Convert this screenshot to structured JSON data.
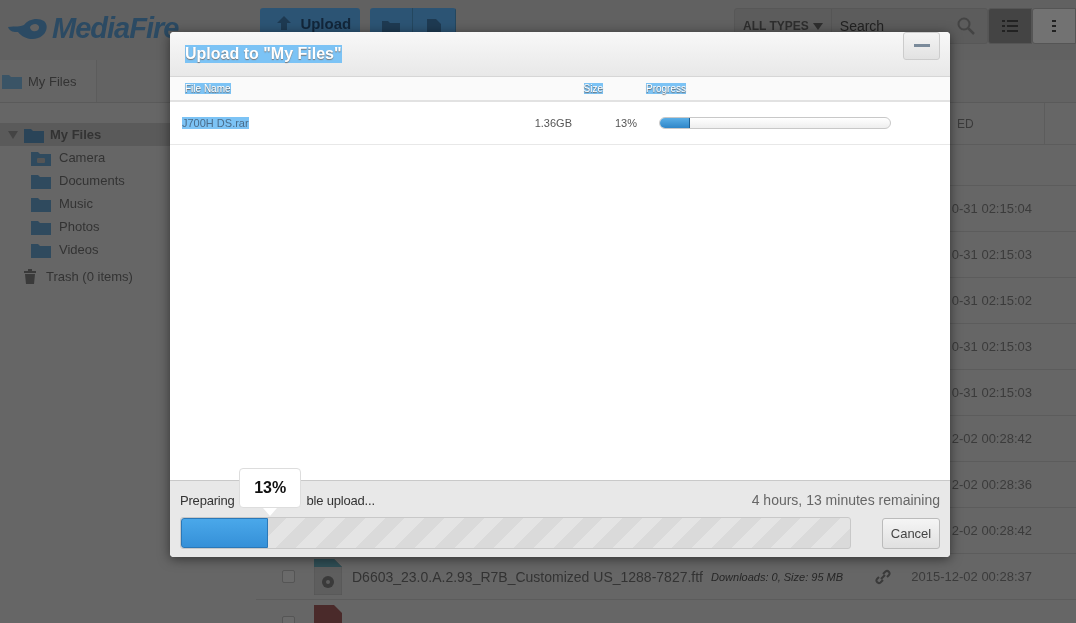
{
  "app": {
    "logo": "MediaFire",
    "upload_button": "Upload",
    "filter": "ALL TYPES",
    "search": {
      "placeholder": "Search"
    },
    "view_buttons": [
      {
        "kind": "list",
        "selected": true
      },
      {
        "kind": "grid",
        "selected": false
      }
    ],
    "breadcrumb": "My Files",
    "sidebar": {
      "tree": [
        {
          "label": "My Files",
          "selected": true,
          "expanded": true,
          "children": [
            {
              "label": "Camera",
              "kind": "camera",
              "selected": false
            },
            {
              "label": "Documents",
              "kind": "folder",
              "selected": false
            },
            {
              "label": "Music",
              "kind": "folder",
              "selected": false
            },
            {
              "label": "Photos",
              "kind": "folder",
              "selected": false
            },
            {
              "label": "Videos",
              "kind": "folder",
              "selected": false
            }
          ]
        }
      ],
      "trash": "Trash (0 items)"
    },
    "list": {
      "column_heading": "ED",
      "rows": [
        {
          "modified": "0-31 02:15:04"
        },
        {
          "modified": "0-31 02:15:03"
        },
        {
          "modified": "0-31 02:15:02"
        },
        {
          "modified": "0-31 02:15:03"
        },
        {
          "modified": "0-31 02:15:03"
        },
        {
          "modified": "2-02 00:28:42"
        },
        {
          "modified": "2-02 00:28:36"
        },
        {
          "modified": "2-02 00:28:42"
        },
        {
          "name": "D6603_23.0.A.2.93_R7B_Customized US_1288-7827.ftf",
          "info": "Downloads: 0, Size: 95 MB",
          "modified": "2015-12-02 00:28:37",
          "kind": "settings",
          "checked": false
        },
        {
          "kind": "pdf",
          "checked": false
        }
      ]
    }
  },
  "dialog": {
    "title": "Upload to \"My Files\"",
    "title_highlighted": true,
    "columns": [
      {
        "label": "File Name",
        "highlighted": true
      },
      {
        "label": "Size",
        "highlighted": true
      },
      {
        "label": "Progress",
        "highlighted": true
      }
    ],
    "files": [
      {
        "name": "J700H DS.rar",
        "highlighted": true,
        "size": "1.36GB",
        "percent": "13%",
        "level": 0.13
      }
    ],
    "status_parts": [
      "Preparing",
      "ble upload..."
    ],
    "tooltip": "13%",
    "remaining": "4 hours, 13 minutes remaining",
    "level": 0.13,
    "cancel": "Cancel"
  }
}
